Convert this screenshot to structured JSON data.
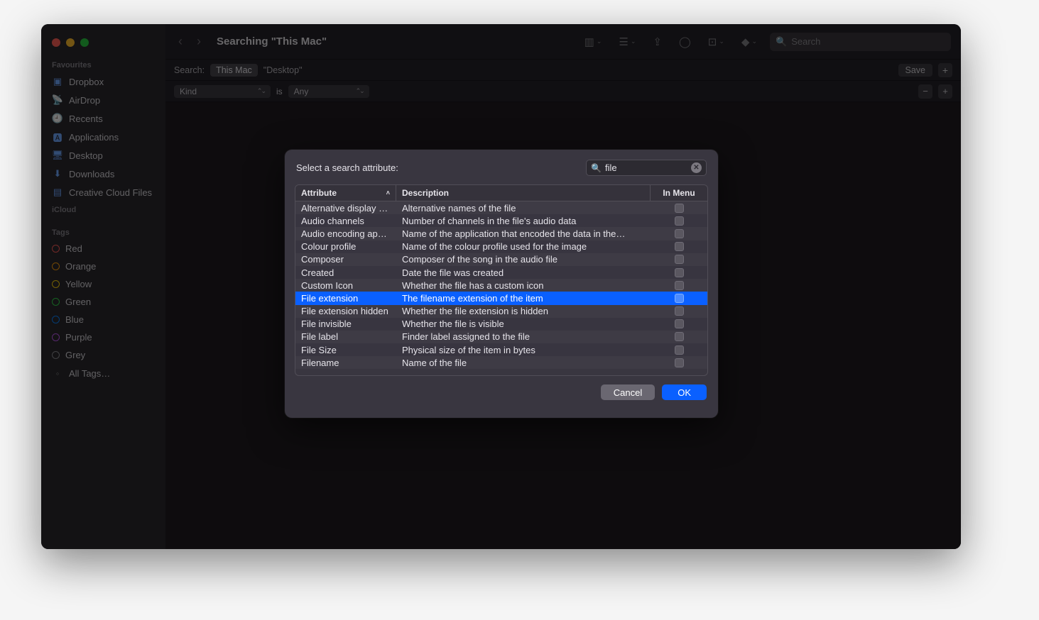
{
  "window": {
    "title": "Searching \"This Mac\""
  },
  "toolbar": {
    "search_placeholder": "Search"
  },
  "sidebar": {
    "favourites_label": "Favourites",
    "favourites": [
      "Dropbox",
      "AirDrop",
      "Recents",
      "Applications",
      "Desktop",
      "Downloads",
      "Creative Cloud Files"
    ],
    "icloud_label": "iCloud",
    "tags_label": "Tags",
    "tags": [
      {
        "name": "Red",
        "color": "#ff5b58"
      },
      {
        "name": "Orange",
        "color": "#ff9f0a"
      },
      {
        "name": "Yellow",
        "color": "#ffd60a"
      },
      {
        "name": "Green",
        "color": "#32d74b"
      },
      {
        "name": "Blue",
        "color": "#0a84ff"
      },
      {
        "name": "Purple",
        "color": "#bf5af2"
      },
      {
        "name": "Grey",
        "color": "#8e8e93"
      }
    ],
    "all_tags_label": "All Tags…"
  },
  "scope": {
    "label": "Search:",
    "this_mac": "This Mac",
    "desktop": "\"Desktop\"",
    "save": "Save",
    "plus": "+"
  },
  "criteria": {
    "kind_label": "Kind",
    "is_label": "is",
    "any_label": "Any"
  },
  "modal": {
    "title": "Select a search attribute:",
    "search_value": "file",
    "col_attribute": "Attribute",
    "col_description": "Description",
    "col_in_menu": "In Menu",
    "cancel": "Cancel",
    "ok": "OK",
    "selected_index": 7,
    "rows": [
      {
        "attr": "Alternative display na…",
        "desc": "Alternative names of the file"
      },
      {
        "attr": "Audio channels",
        "desc": "Number of channels in the file's audio data"
      },
      {
        "attr": "Audio encoding appli…",
        "desc": "Name of the application that encoded the data in the…"
      },
      {
        "attr": "Colour profile",
        "desc": "Name of the colour profile used for the image"
      },
      {
        "attr": "Composer",
        "desc": "Composer of the song in the audio file"
      },
      {
        "attr": "Created",
        "desc": "Date the file was created"
      },
      {
        "attr": "Custom Icon",
        "desc": "Whether the file has a custom icon"
      },
      {
        "attr": "File extension",
        "desc": "The filename extension of the item"
      },
      {
        "attr": "File extension hidden",
        "desc": "Whether the file extension is hidden"
      },
      {
        "attr": "File invisible",
        "desc": "Whether the file is visible"
      },
      {
        "attr": "File label",
        "desc": "Finder label assigned to the file"
      },
      {
        "attr": "File Size",
        "desc": "Physical size of the item in bytes"
      },
      {
        "attr": "Filename",
        "desc": "Name of the file"
      }
    ]
  }
}
